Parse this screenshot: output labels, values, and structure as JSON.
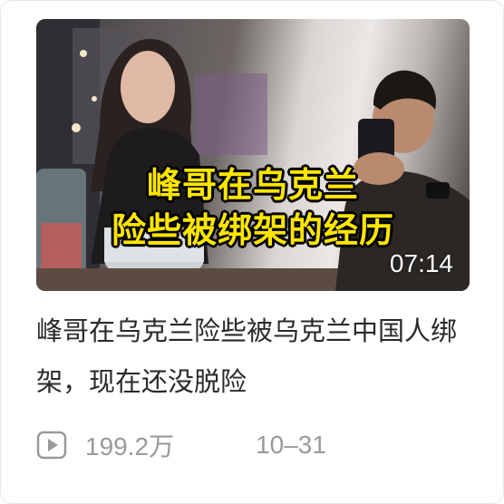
{
  "video": {
    "overlay_line1": "峰哥在乌克兰",
    "overlay_line2": "险些被绑架的经历",
    "duration": "07:14",
    "title": "峰哥在乌克兰险些被乌克兰中国人绑架，现在还没脱险",
    "views": "199.2万",
    "date": "10–31",
    "play_count_icon": "play-count-icon"
  }
}
